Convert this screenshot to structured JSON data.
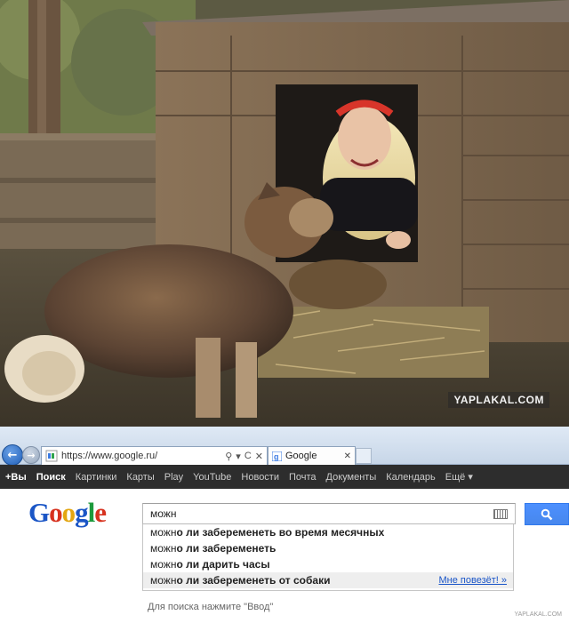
{
  "photo": {
    "watermark": "YAPLAKAL.COM"
  },
  "browser": {
    "address": "https://www.google.ru/",
    "address_tools": [
      "⚲",
      "▾",
      "C",
      "✕"
    ],
    "tab_title": "Google",
    "tab_close": "✕"
  },
  "gbar": {
    "items": [
      "+Вы",
      "Поиск",
      "Картинки",
      "Карты",
      "Play",
      "YouTube",
      "Новости",
      "Почта",
      "Документы",
      "Календарь",
      "Ещё ▾"
    ]
  },
  "google": {
    "logo_letters": [
      {
        "ch": "G",
        "color": "#1b56c6"
      },
      {
        "ch": "o",
        "color": "#d7321f"
      },
      {
        "ch": "o",
        "color": "#e3a611"
      },
      {
        "ch": "g",
        "color": "#1b56c6"
      },
      {
        "ch": "l",
        "color": "#1d9a3c"
      },
      {
        "ch": "e",
        "color": "#d7321f"
      }
    ],
    "query": "можн",
    "suggestions": [
      {
        "prefix": "можн",
        "rest": "о ли забеременеть во время месячных"
      },
      {
        "prefix": "можн",
        "rest": "о ли забеременеть"
      },
      {
        "prefix": "можн",
        "rest": "о ли дарить часы"
      },
      {
        "prefix": "можн",
        "rest": "о ли забеременеть от собаки"
      }
    ],
    "lucky_label": "Мне повезёт! »",
    "hint": "Для поиска нажмите \"Ввод\"",
    "small_watermark": "YAPLAKAL.COM"
  }
}
